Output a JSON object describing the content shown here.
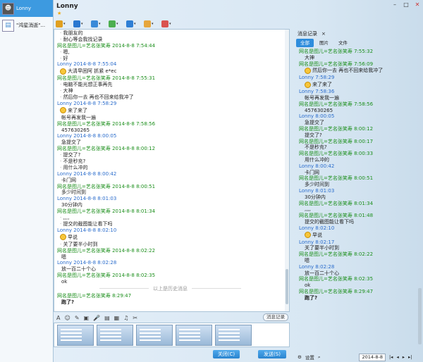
{
  "contacts": [
    {
      "name": "Lonny",
      "active": true
    },
    {
      "name": "\"鸿星消逝\"...",
      "active": false
    }
  ],
  "window": {
    "title": "Lonny",
    "star": "★",
    "controls": [
      "–",
      "□",
      "✕"
    ]
  },
  "toolbar": {
    "icons": [
      "microphone-icon",
      "video-icon",
      "folder-icon",
      "remote-icon",
      "screen-icon",
      "app-icon",
      "grid-icon"
    ],
    "colors": [
      "#e0a020",
      "#2a78d0",
      "#3a8ad8",
      "#4caf50",
      "#2f7fd5",
      "#e6a63c",
      "#d9534f"
    ]
  },
  "chat": {
    "messages": [
      {
        "kind": "bullet",
        "text": "我朋友的"
      },
      {
        "kind": "bullet",
        "text": "耐心等会我找记录"
      },
      {
        "kind": "meta",
        "text": "网名是图儿=艺名张笑寿  2014-8-8 7:54:44"
      },
      {
        "kind": "bullet",
        "text": "嗯,"
      },
      {
        "kind": "bullet",
        "text": "好"
      },
      {
        "kind": "meta_me",
        "text": "Lonny  2014-8-8 7:55:04"
      },
      {
        "kind": "emo",
        "text": "大清早困阿  抓紧 e*ec"
      },
      {
        "kind": "meta",
        "text": "网名是图儿=艺名张笑寿  2014-8-8 7:55:31"
      },
      {
        "kind": "bullet",
        "text": "电脑不能光想正事再先"
      },
      {
        "kind": "bullet",
        "text": "大神"
      },
      {
        "kind": "bullet",
        "text": "然后你一去  再也不回来给我冲了"
      },
      {
        "kind": "meta_me",
        "text": "Lonny  2014-8-8 7:58:29"
      },
      {
        "kind": "emo",
        "text": "来了来了"
      },
      {
        "kind": "text",
        "text": "帐号再发我一遍"
      },
      {
        "kind": "meta",
        "text": "网名是图儿=艺名张笑寿  2014-8-8 7:58:56"
      },
      {
        "kind": "text",
        "text": "457630265"
      },
      {
        "kind": "meta_me",
        "text": "Lonny  2014-8-8 8:00:05"
      },
      {
        "kind": "text",
        "text": "急提交了"
      },
      {
        "kind": "meta",
        "text": "网名是图儿=艺名张笑寿  2014-8-8 8:00:12"
      },
      {
        "kind": "bullet",
        "text": "提交了?"
      },
      {
        "kind": "bullet",
        "text": "不是秒充?"
      },
      {
        "kind": "bullet",
        "text": "用什么冲的"
      },
      {
        "kind": "meta_me",
        "text": "Lonny  2014-8-8 8:00:42"
      },
      {
        "kind": "text",
        "text": "卡门网"
      },
      {
        "kind": "meta",
        "text": "网名是图儿=艺名张笑寿  2014-8-8 8:00:51"
      },
      {
        "kind": "text",
        "text": "多少时间到"
      },
      {
        "kind": "meta_me",
        "text": "Lonny  2014-8-8 8:01:03"
      },
      {
        "kind": "text",
        "text": "30分钟内"
      },
      {
        "kind": "meta",
        "text": "网名是图儿=艺名张笑寿  2014-8-8 8:01:34"
      },
      {
        "kind": "bullet",
        "text": ",,,,"
      },
      {
        "kind": "bullet",
        "text": "提交的截图能让看下吗"
      },
      {
        "kind": "meta_me",
        "text": "Lonny  2014-8-8 8:02:10"
      },
      {
        "kind": "emo",
        "text": "早说"
      },
      {
        "kind": "bullet",
        "text": "关了要半小时到"
      },
      {
        "kind": "meta",
        "text": "网名是图儿=艺名张笑寿  2014-8-8 8:02:22"
      },
      {
        "kind": "text",
        "text": "嗯"
      },
      {
        "kind": "meta_me",
        "text": "Lonny  2014-8-8 8:02:28"
      },
      {
        "kind": "text",
        "text": "放一百二十个心"
      },
      {
        "kind": "meta",
        "text": "网名是图儿=艺名张笑寿  2014-8-8 8:02:35"
      },
      {
        "kind": "text",
        "text": "ok"
      },
      {
        "kind": "sep",
        "text": "以上是历史消息"
      },
      {
        "kind": "meta",
        "text": "网名是图儿=艺名张笑寿   8:29:47"
      },
      {
        "kind": "textbold",
        "text": "跑了?"
      }
    ]
  },
  "input": {
    "tools": [
      "A",
      "☺",
      "✎",
      "▣",
      "🎤",
      "▤",
      "▦",
      "♫",
      "✂"
    ],
    "history_button": "消息记录"
  },
  "buttons": {
    "close": "关闭(C)",
    "send": "发送(S)"
  },
  "history": {
    "tab_label": "消息记录",
    "tab_close": "×",
    "subtabs": [
      "全部",
      "图片",
      "文件"
    ],
    "messages": [
      {
        "kind": "meta",
        "text": "网名是图儿=艺名张笑寿 7:55:32"
      },
      {
        "kind": "text",
        "text": "大神"
      },
      {
        "kind": "meta",
        "text": "网名是图儿=艺名张笑寿 7:56:09"
      },
      {
        "kind": "emo",
        "text": "然后你一去  再也不回来给我冲了"
      },
      {
        "kind": "meta_me",
        "text": "Lonny  7:58:29"
      },
      {
        "kind": "emo",
        "text": "来了来了"
      },
      {
        "kind": "meta_me",
        "text": "Lonny  7:58:36"
      },
      {
        "kind": "text",
        "text": "帐号再发我一遍"
      },
      {
        "kind": "meta",
        "text": "网名是图儿=艺名张笑寿 7:58:56"
      },
      {
        "kind": "text",
        "text": "457630265"
      },
      {
        "kind": "meta_me",
        "text": "Lonny  8:00:05"
      },
      {
        "kind": "text",
        "text": "急提交了"
      },
      {
        "kind": "meta",
        "text": "网名是图儿=艺名张笑寿 8:00:12"
      },
      {
        "kind": "text",
        "text": "提交了?"
      },
      {
        "kind": "meta",
        "text": "网名是图儿=艺名张笑寿 8:00:17"
      },
      {
        "kind": "text",
        "text": "不是秒充?"
      },
      {
        "kind": "meta",
        "text": "网名是图儿=艺名张笑寿 8:00:33"
      },
      {
        "kind": "text",
        "text": "用什么冲的"
      },
      {
        "kind": "meta_me",
        "text": "Lonny  8:00:42"
      },
      {
        "kind": "text",
        "text": "卡门网"
      },
      {
        "kind": "meta",
        "text": "网名是图儿=艺名张笑寿 8:00:51"
      },
      {
        "kind": "text",
        "text": "多少时间到"
      },
      {
        "kind": "meta_me",
        "text": "Lonny  8:01:03"
      },
      {
        "kind": "text",
        "text": "30分钟内"
      },
      {
        "kind": "meta",
        "text": "网名是图儿=艺名张笑寿 8:01:34"
      },
      {
        "kind": "text",
        "text": ",,,,"
      },
      {
        "kind": "meta",
        "text": "网名是图儿=艺名张笑寿 8:01:48"
      },
      {
        "kind": "text",
        "text": "提交的截图能让看下吗"
      },
      {
        "kind": "meta_me",
        "text": "Lonny  8:02:10"
      },
      {
        "kind": "emo",
        "text": "早说"
      },
      {
        "kind": "meta_me",
        "text": "Lonny  8:02:17"
      },
      {
        "kind": "text",
        "text": "关了要半小时到"
      },
      {
        "kind": "meta",
        "text": "网名是图儿=艺名张笑寿 8:02:22"
      },
      {
        "kind": "text",
        "text": "嗯"
      },
      {
        "kind": "meta_me",
        "text": "Lonny  8:02:28"
      },
      {
        "kind": "text",
        "text": "放一百二十个心"
      },
      {
        "kind": "meta",
        "text": "网名是图儿=艺名张笑寿 8:02:35"
      },
      {
        "kind": "text",
        "text": "ok"
      },
      {
        "kind": "meta",
        "text": "网名是图儿=艺名张笑寿 8:29:47"
      },
      {
        "kind": "textbold",
        "text": "跑了?"
      }
    ],
    "footer": {
      "settings": "设置",
      "date": "2014-8-8"
    }
  }
}
